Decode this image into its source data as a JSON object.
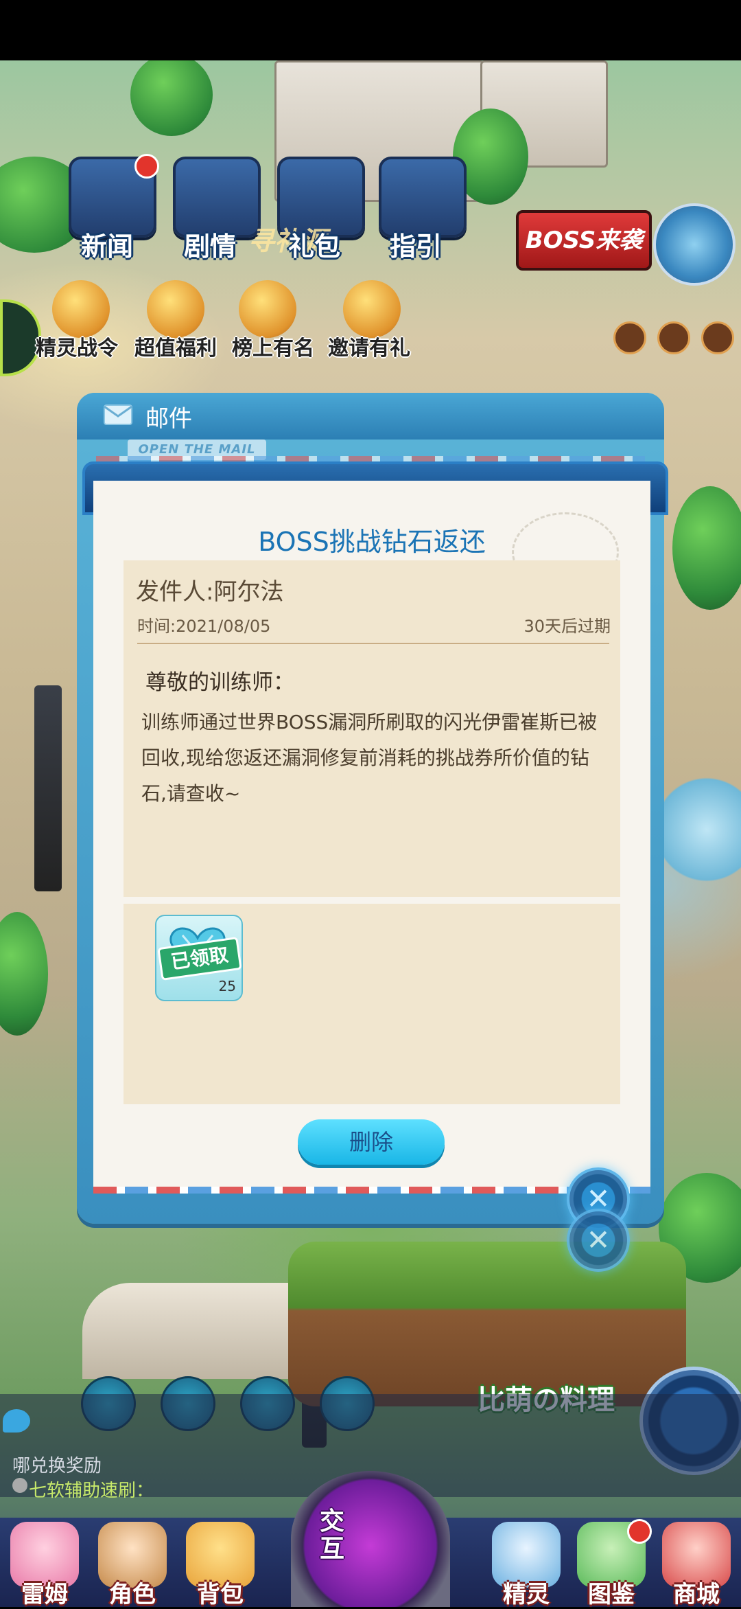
{
  "top_menu": {
    "items": [
      {
        "label": "新闻",
        "icon": "newspaper-icon",
        "badge": true
      },
      {
        "label": "剧情",
        "icon": "story-chest-icon",
        "badge": false
      },
      {
        "label": "礼包",
        "icon": "gift-chest-icon",
        "badge": false
      },
      {
        "label": "指引",
        "icon": "guide-chest-icon",
        "badge": false
      }
    ],
    "gift_source_label": "寻礼源",
    "boss_banner": "BOSS来袭"
  },
  "activities": [
    {
      "label": "精灵战令",
      "icon": "battle-pass-icon"
    },
    {
      "label": "超值福利",
      "icon": "gift-box-icon"
    },
    {
      "label": "榜上有名",
      "icon": "trophy-icon"
    },
    {
      "label": "邀请有礼",
      "icon": "invite-envelope-icon"
    }
  ],
  "mail_dialog": {
    "header_title": "邮件",
    "open_tag": "OPEN THE MAIL",
    "subject": "BOSS挑战钻石返还",
    "sender": "发件人:阿尔法",
    "time": "时间:2021/08/05",
    "expiry": "30天后过期",
    "greeting": "尊敬的训练师：",
    "body": "训练师通过世界BOSS漏洞所刷取的闪光伊雷崔斯已被回收,现给您返还漏洞修复前消耗的挑战券所价值的钻石,请查收~",
    "attachments": [
      {
        "icon": "diamond-heart-icon",
        "status": "已领取",
        "count": "25"
      }
    ],
    "delete_label": "删除",
    "close_symbol": "✕"
  },
  "chat": {
    "line1": "哪兑换奖励",
    "line2": "七软辅助速刷："
  },
  "cook_banner": "比萌の料理",
  "bottom_nav": [
    {
      "label": "雷姆",
      "icon": "pink-creature-icon",
      "color": "#e87aa8"
    },
    {
      "label": "角色",
      "icon": "character-icon",
      "color": "#c58a4a"
    },
    {
      "label": "背包",
      "icon": "backpack-icon",
      "color": "#e8a33a"
    },
    {
      "label": "交互",
      "icon": "interact-portal-icon",
      "color": "#b03fd0"
    },
    {
      "label": "精灵",
      "icon": "panda-creature-icon",
      "color": "#6ab0e0"
    },
    {
      "label": "图鉴",
      "icon": "pokedex-icon",
      "color": "#5aba5a"
    },
    {
      "label": "商城",
      "icon": "shop-icon",
      "color": "#d84a4a"
    }
  ],
  "colors": {
    "accent_blue": "#1b74b5",
    "paper": "#f7f4ee",
    "letter_bg": "#f1e6cf",
    "delete_button": "#19b6e6"
  }
}
